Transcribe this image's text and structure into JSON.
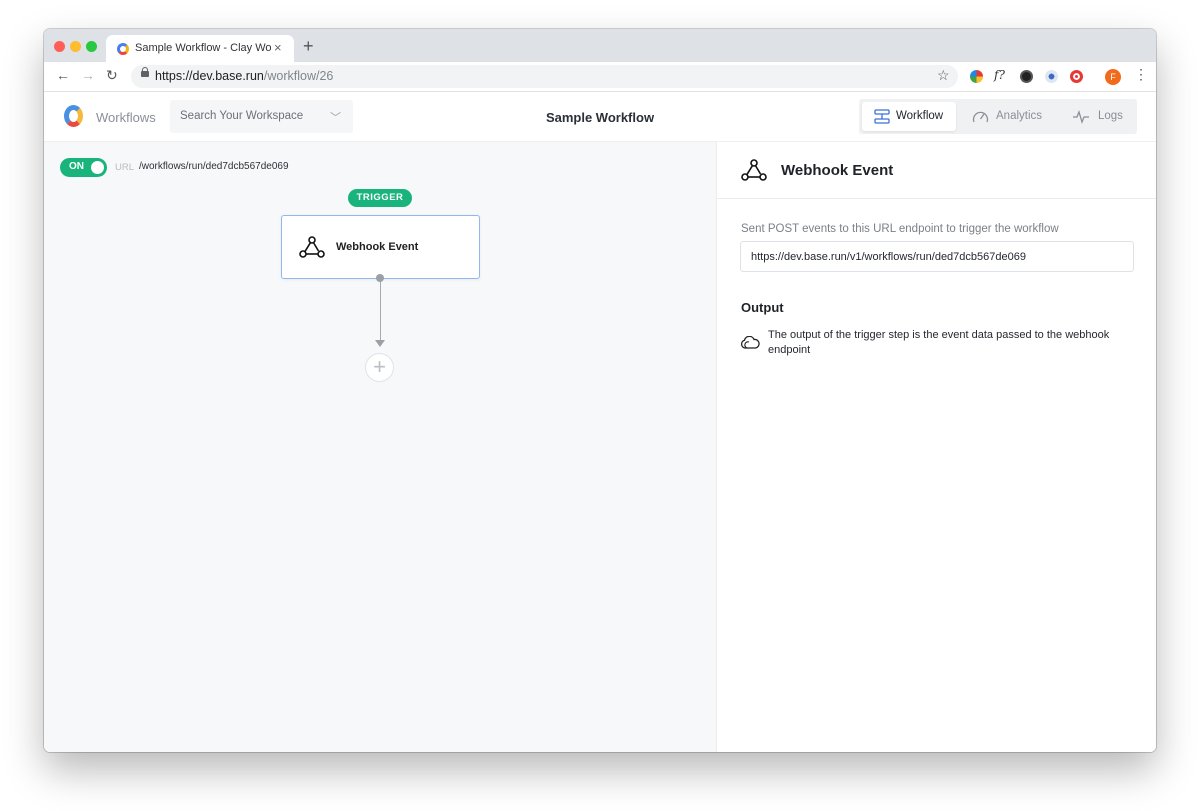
{
  "browser": {
    "tab_title": "Sample Workflow - Clay Workflows",
    "tab_close": "×",
    "new_tab": "+",
    "url_host": "https://dev.base.run",
    "url_path": "/workflow/26",
    "back": "←",
    "forward": "→",
    "reload": "↻",
    "star": "☆",
    "ext_function": "f?",
    "avatar_initial": "F",
    "menu": "⋮",
    "traffic_colors": [
      "#ff5f57",
      "#febc2e",
      "#28c840"
    ]
  },
  "header": {
    "nav_workflows": "Workflows",
    "search_placeholder": "Search Your Workspace",
    "search_chevron": "﹀",
    "page_title": "Sample Workflow",
    "tabs": [
      {
        "label": "Workflow",
        "icon": "workflow-icon",
        "active": true
      },
      {
        "label": "Analytics",
        "icon": "gauge-icon",
        "active": false
      },
      {
        "label": "Logs",
        "icon": "pulse-icon",
        "active": false
      }
    ]
  },
  "canvas": {
    "toggle_label": "ON",
    "url_label": "URL",
    "url_value": "/workflows/run/ded7dcb567de069",
    "trigger_badge": "TRIGGER",
    "card_title": "Webhook Event",
    "add_step": "+"
  },
  "panel": {
    "title": "Webhook Event",
    "description": "Sent POST events to this URL endpoint to trigger the workflow",
    "endpoint_url": "https://dev.base.run/v1/workflows/run/ded7dcb567de069",
    "output_heading": "Output",
    "output_text": "The output of the trigger step is the event data passed to the webhook endpoint"
  },
  "colors": {
    "accent_green": "#18b47c",
    "card_border": "#8fb8f0",
    "canvas_bg": "#f7f8fa"
  }
}
